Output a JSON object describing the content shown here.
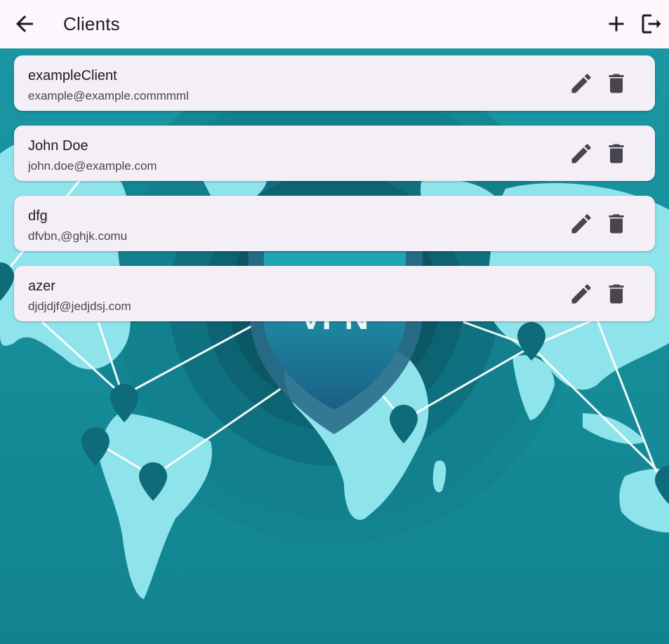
{
  "appbar": {
    "title": "Clients",
    "icons": [
      "back-arrow-icon",
      "add-icon",
      "logout-icon"
    ]
  },
  "background": {
    "shield_text": "VPN"
  },
  "clients": [
    {
      "name": "exampleClient",
      "email": "example@example.commmml"
    },
    {
      "name": "John Doe",
      "email": "john.doe@example.com"
    },
    {
      "name": "dfg",
      "email": "dfvbn,@ghjk.comu"
    },
    {
      "name": "azer",
      "email": "djdjdjf@jedjdsj.com"
    }
  ],
  "row_icons": [
    "edit-icon",
    "delete-icon"
  ],
  "colors": {
    "appbar_bg": "#fdf7fd",
    "card_bg": "#f4eff6",
    "icon_color": "#49454f",
    "teal_bg": "#17909c",
    "map_land": "#8fe3ea",
    "pin": "#0e6b7a"
  }
}
